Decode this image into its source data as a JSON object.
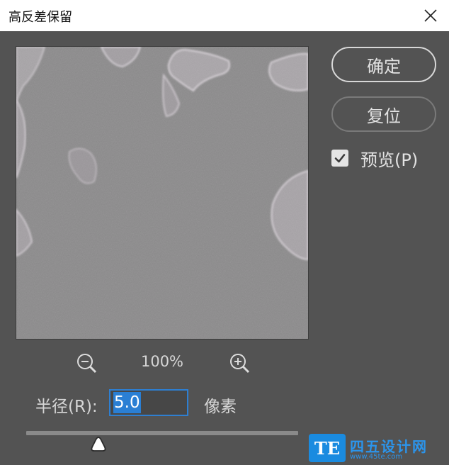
{
  "dialog": {
    "title": "高反差保留",
    "close_icon": "close-icon"
  },
  "preview": {
    "zoom_level": "100%",
    "zoom_out_icon": "zoom-out-icon",
    "zoom_in_icon": "zoom-in-icon"
  },
  "buttons": {
    "ok_label": "确定",
    "reset_label": "复位"
  },
  "preview_checkbox": {
    "label": "预览(P)",
    "checked": true
  },
  "radius": {
    "label": "半径(R):",
    "value": "5.0",
    "unit": "像素"
  },
  "slider": {
    "value_fraction": 0.265
  },
  "watermark": {
    "logo_text": "TE",
    "title": "四五设计网",
    "url": "www.45te.com"
  },
  "colors": {
    "dialog_bg": "#535353",
    "accent": "#2a7fd4",
    "watermark": "#1a8be0"
  }
}
